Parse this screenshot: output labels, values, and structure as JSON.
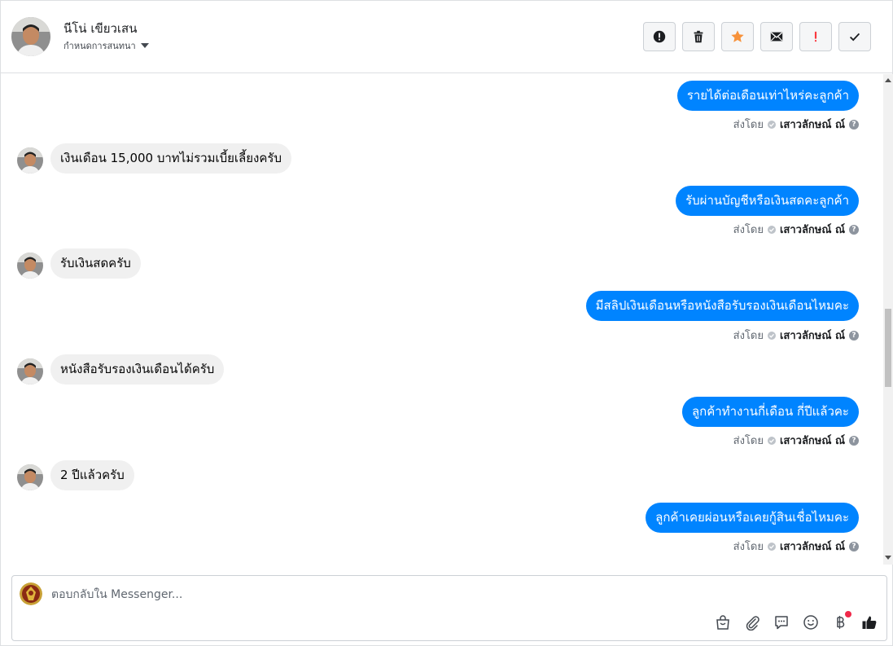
{
  "header": {
    "customer_name": "นีโน่ เขียวเสน",
    "assign_label": "กำหนดการสนทนา",
    "actions": [
      {
        "icon": "alert-circle-icon"
      },
      {
        "icon": "trash-icon"
      },
      {
        "icon": "star-icon"
      },
      {
        "icon": "envelope-icon"
      },
      {
        "icon": "exclamation-icon"
      },
      {
        "icon": "checkmark-icon"
      }
    ]
  },
  "thread": {
    "sent_by_prefix": "ส่งโดย",
    "agent_name": "เสาวลักษณ์ ณ์",
    "help_glyph": "?",
    "messages": [
      {
        "from": "page",
        "text": "รายได้ต่อเดือนเท่าไหร่คะลูกค้า"
      },
      {
        "from": "customer",
        "text": "เงินเดือน 15,000 บาทไม่รวมเบี้ยเลี้ยงครับ"
      },
      {
        "from": "page",
        "text": "รับผ่านบัญชีหรือเงินสดคะลูกค้า"
      },
      {
        "from": "customer",
        "text": "รับเงินสดครับ"
      },
      {
        "from": "page",
        "text": "มีสลิปเงินเดือนหรือหนังสือรับรองเงินเดือนไหมคะ"
      },
      {
        "from": "customer",
        "text": "หนังสือรับรองเงินเดือนได้ครับ"
      },
      {
        "from": "page",
        "text": "ลูกค้าทำงานกี่เดือน กี่ปีแล้วคะ"
      },
      {
        "from": "customer",
        "text": "2 ปีแล้วครับ"
      },
      {
        "from": "page",
        "text": "ลูกค้าเคยผ่อนหรือเคยกู้สินเชื่อไหมคะ"
      }
    ]
  },
  "composer": {
    "placeholder": "ตอบกลับใน Messenger...",
    "tools": [
      "shopping-bag-icon",
      "paperclip-icon",
      "saved-reply-icon",
      "emoji-icon",
      "baht-payment-icon",
      "thumbs-up-icon"
    ]
  },
  "colors": {
    "outgoing_bubble": "#0084ff",
    "incoming_bubble": "#f0f0f0",
    "star": "#f7923b",
    "alert_red": "#fa383e",
    "notification_dot": "#f02849"
  }
}
